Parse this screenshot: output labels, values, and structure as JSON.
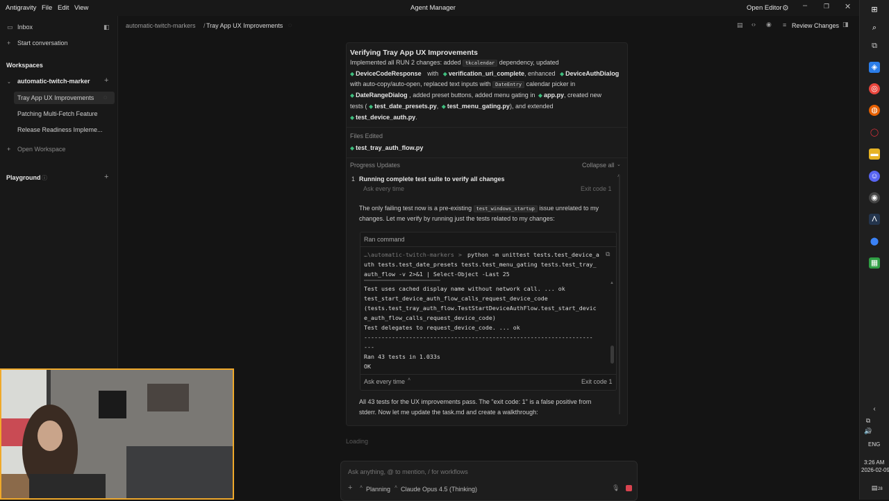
{
  "titlebar": {
    "menu": [
      "Antigravity",
      "File",
      "Edit",
      "View"
    ],
    "title": "Agent Manager",
    "open_editor": "Open Editor"
  },
  "sidebar": {
    "inbox": "Inbox",
    "start_conversation": "Start conversation",
    "workspaces_title": "Workspaces",
    "workspace_name": "automatic-twitch-marker",
    "conversations": [
      "Tray App UX Improvements",
      "Patching Multi-Fetch Feature",
      "Release Readiness Impleme..."
    ],
    "open_workspace": "Open Workspace",
    "playground": "Playground"
  },
  "header": {
    "crumb_workspace": "automatic-twitch-markers",
    "crumb_sep": "/",
    "crumb_task": "Tray App UX Improvements",
    "review_changes": "Review Changes"
  },
  "card": {
    "title": "Verifying Tray App UX Improvements",
    "l1a": "Implemented all RUN 2 changes: added",
    "code_tkcalendar": "tkcalendar",
    "l1b": "dependency, updated",
    "DeviceCodeResponse": "DeviceCodeResponse",
    "with1": "with",
    "verification_uri_complete": "verification_uri_complete",
    "enhanced": ", enhanced",
    "DeviceAuthDialog": "DeviceAuthDialog",
    "l3a": "with auto-copy/auto-open, replaced text inputs with",
    "code_DateEntry": "DateEntry",
    "l3b": "calendar picker in",
    "DateRangeDialog": "DateRangeDialog",
    "l4a": ", added preset buttons, added menu gating in",
    "app_py": "app.py",
    "l4b": ", created new",
    "tests_open": "tests (",
    "test_date_presets": "test_date_presets.py",
    "comma": ",",
    "test_menu_gating": "test_menu_gating.py",
    "l5b": "), and extended",
    "test_device_auth": "test_device_auth.py",
    "period": ".",
    "files_edited": "Files Edited",
    "file1": "test_tray_auth_flow.py",
    "progress_updates": "Progress Updates",
    "collapse_all": "Collapse all",
    "step_num": "1",
    "step_title": "Running complete test suite to verify all changes",
    "ask_every_time": "Ask every time",
    "exit_code": "Exit code 1",
    "p1a": "The only failing test now is a pre-existing",
    "code_startup": "test_windows_startup",
    "p1b": "issue unrelated to my",
    "p1c": "changes. Let me verify by running just the tests related to my changes:",
    "ran_command": "Ran command",
    "cmd_path": "…\\automatic-twitch-markers",
    "cmd_prompt": ">",
    "cmd_lines": [
      "python -m unittest tests.test_device_a",
      "uth tests.test_date_presets tests.test_menu_gating tests.test_tray_",
      "auth_flow -v 2>&1 | Select-Object -Last 25"
    ],
    "output_lines": [
      "Test uses cached display name without network call. ... ok",
      "test_start_device_auth_flow_calls_request_device_code",
      "(tests.test_tray_auth_flow.TestStartDeviceAuthFlow.test_start_devic",
      "e_auth_flow_calls_request_device_code)",
      "Test delegates to request_device_code. ... ok",
      "------------------------------------------------------------------",
      "---",
      "Ran 43 tests in 1.033s",
      "OK"
    ],
    "p2a": "All 43 tests for the UX improvements pass. The \"exit code: 1\" is a false positive from",
    "p2b": "stderr. Now let me update the task.md and create a walkthrough:"
  },
  "loading": "Loading",
  "input": {
    "placeholder": "Ask anything, @ to mention, / for workflows",
    "mode": "Planning",
    "model": "Claude Opus 4.5 (Thinking)"
  },
  "taskbar": {
    "lang": "ENG",
    "time": "3:26 AM",
    "date": "2026-02-09",
    "notif": "28"
  },
  "colors": {
    "accent": "#3fbf7f",
    "webcam_border": "#f0a92a"
  }
}
